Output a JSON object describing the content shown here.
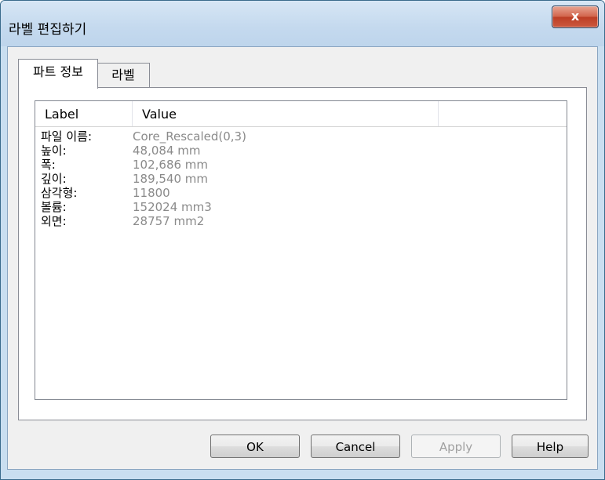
{
  "window": {
    "title": "라벨 편집하기",
    "close_label": "x"
  },
  "tabs": [
    {
      "label": "파트 정보",
      "active": true
    },
    {
      "label": "라벨",
      "active": false
    }
  ],
  "list": {
    "columns": [
      "Label",
      "Value",
      ""
    ],
    "rows": [
      {
        "label": "파일 이름:",
        "value": "Core_Rescaled(0,3)"
      },
      {
        "label": "높이:",
        "value": "48,084 mm"
      },
      {
        "label": "폭:",
        "value": "102,686 mm"
      },
      {
        "label": "깊이:",
        "value": "189,540 mm"
      },
      {
        "label": "삼각형:",
        "value": "11800"
      },
      {
        "label": "볼륨:",
        "value": "152024 mm3"
      },
      {
        "label": "외면:",
        "value": "28757 mm2"
      }
    ]
  },
  "buttons": {
    "ok": "OK",
    "cancel": "Cancel",
    "apply": "Apply",
    "help": "Help"
  }
}
